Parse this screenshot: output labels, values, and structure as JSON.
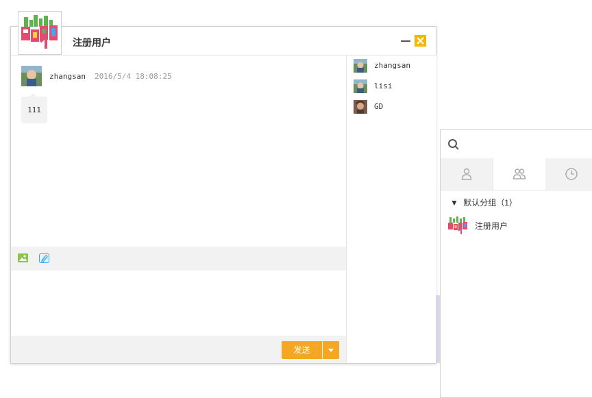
{
  "chat_window": {
    "title": "注册用户",
    "messages": [
      {
        "user": "zhangsan",
        "time": "2016/5/4 18:08:25",
        "text": "111"
      }
    ],
    "toolbar": {
      "image_icon": "image-icon",
      "attach_icon": "paperclip-icon"
    },
    "send_label": "发送",
    "members": [
      {
        "name": "zhangsan"
      },
      {
        "name": "lisi"
      },
      {
        "name": "GD"
      }
    ]
  },
  "main_panel": {
    "search_placeholder": "",
    "tabs": [
      {
        "icon": "person-icon",
        "active": false
      },
      {
        "icon": "group-icon",
        "active": true
      },
      {
        "icon": "clock-icon",
        "active": false
      }
    ],
    "group": {
      "arrow": "▼",
      "label": "默认分组（1）",
      "items": [
        {
          "name": "注册用户"
        }
      ]
    }
  },
  "colors": {
    "accent": "#f5a623",
    "close": "#f5b800",
    "tool_green": "#8cc63f",
    "tool_blue": "#3fa9f5"
  }
}
